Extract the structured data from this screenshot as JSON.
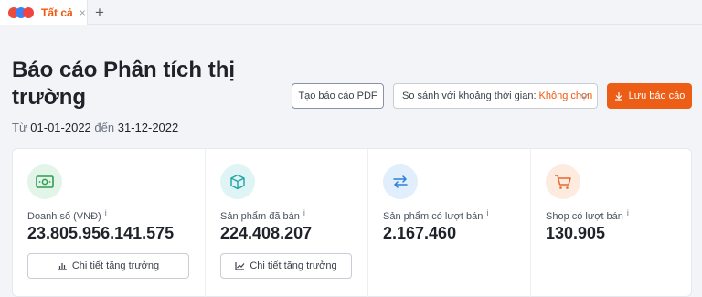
{
  "tabs": [
    {
      "label": "Tất cả",
      "close": "×"
    }
  ],
  "tab_add": "+",
  "header": {
    "title": "Báo cáo Phân tích thị trường",
    "date_from_label": "Từ",
    "date_from": "01-01-2022",
    "date_to_label": "đến",
    "date_to": "31-12-2022"
  },
  "actions": {
    "pdf_label": "Tạo báo cáo PDF",
    "compare_label": "So sánh với khoảng thời gian:",
    "compare_value": "Không chọn",
    "save_label": "Lưu báo cáo"
  },
  "stats": [
    {
      "label": "Doanh số (VNĐ)",
      "value": "23.805.956.141.575",
      "button": "Chi tiết tăng trưởng",
      "icon": "money-icon",
      "icon_color": "#2e9e4f",
      "icon_bg": "#e3f5e8"
    },
    {
      "label": "Sản phẩm đã bán",
      "value": "224.408.207",
      "button": "Chi tiết tăng trưởng",
      "icon": "box-icon",
      "icon_color": "#21a3a3",
      "icon_bg": "#dff4f4"
    },
    {
      "label": "Sản phẩm có lượt bán",
      "value": "2.167.460",
      "icon": "transfer-icon",
      "icon_color": "#2d7fd6",
      "icon_bg": "#e1eefb"
    },
    {
      "label": "Shop có lượt bán",
      "value": "130.905",
      "icon": "cart-icon",
      "icon_color": "#e8692a",
      "icon_bg": "#fdebe0"
    }
  ],
  "info_marker": "i",
  "colors": {
    "accent": "#ec5e16",
    "accent_text": "#f0590e"
  }
}
